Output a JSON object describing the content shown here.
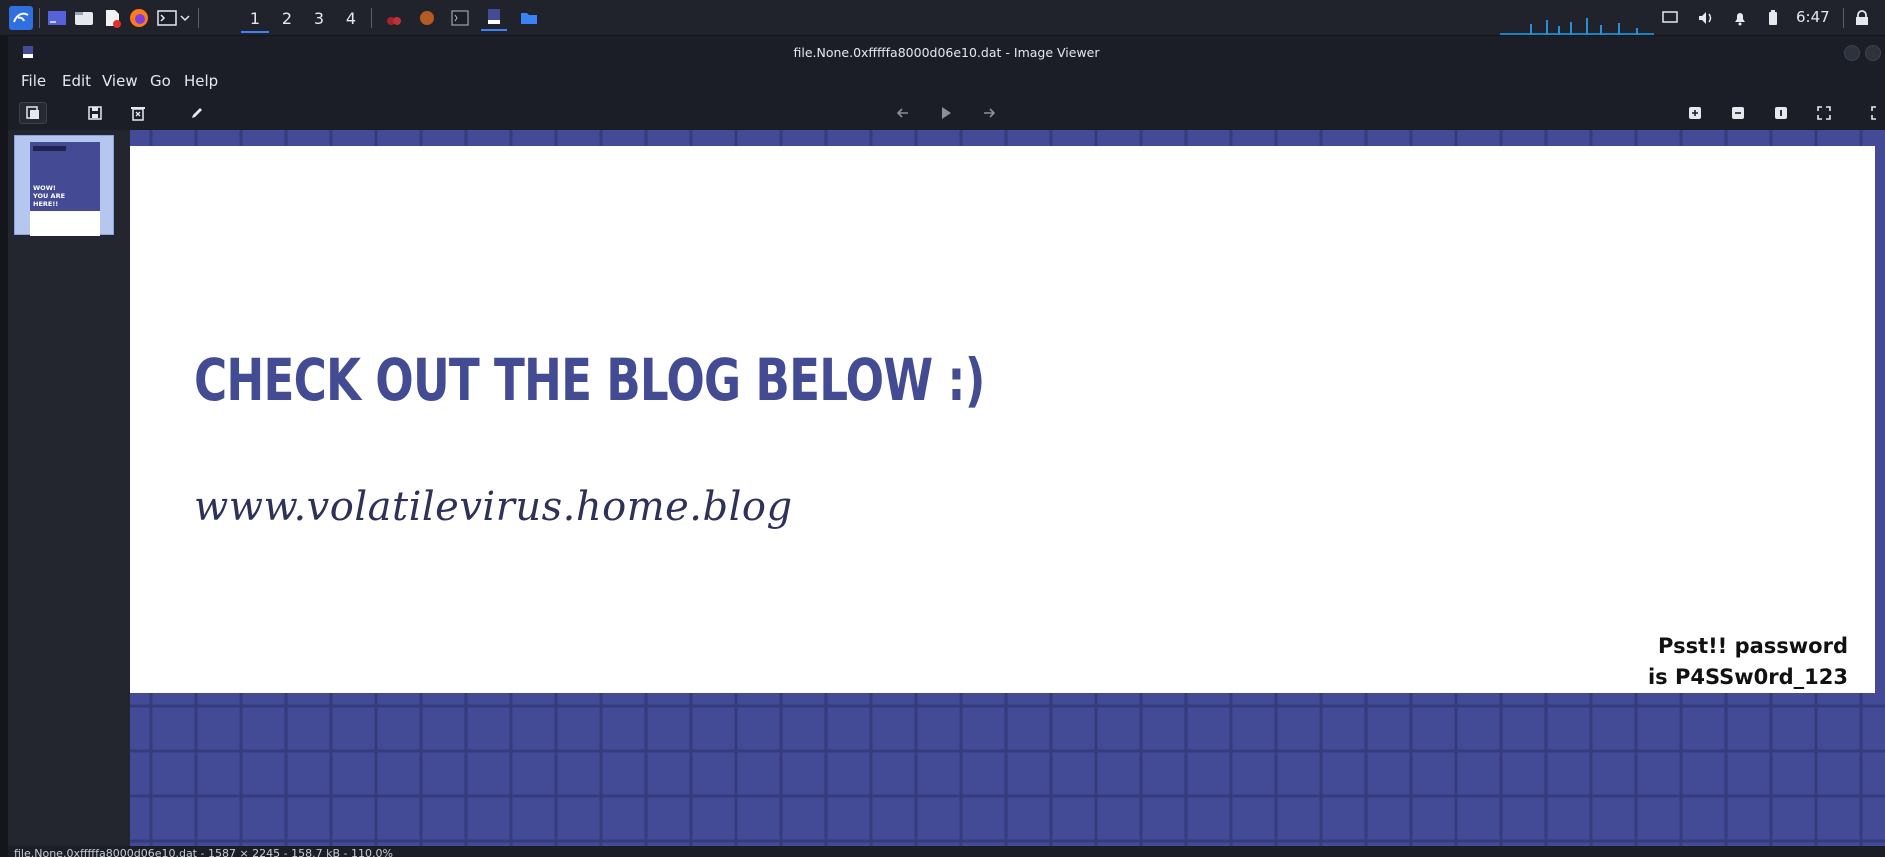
{
  "panel": {
    "workspaces": [
      "1",
      "2",
      "3",
      "4"
    ],
    "active_workspace_index": 0,
    "clock": "6:47",
    "accent_color": "#3b82f6"
  },
  "window": {
    "title": "file.None.0xfffffa8000d06e10.dat - Image Viewer"
  },
  "menubar": {
    "items": [
      "File",
      "Edit",
      "View",
      "Go",
      "Help"
    ]
  },
  "image": {
    "headline": "CHECK OUT THE BLOG BELOW :)",
    "url": "www.volatilevirus.home.blog",
    "psst_line1": "Psst!! password",
    "psst_line2": "is P4SSw0rd_123",
    "accent_color": "#444b96",
    "thumb_text": "WOW! YOU ARE HERE!!"
  },
  "statusbar": {
    "text": "file.None.0xfffffa8000d06e10.dat - 1587 × 2245 - 158.7 kB - 110.0%"
  }
}
